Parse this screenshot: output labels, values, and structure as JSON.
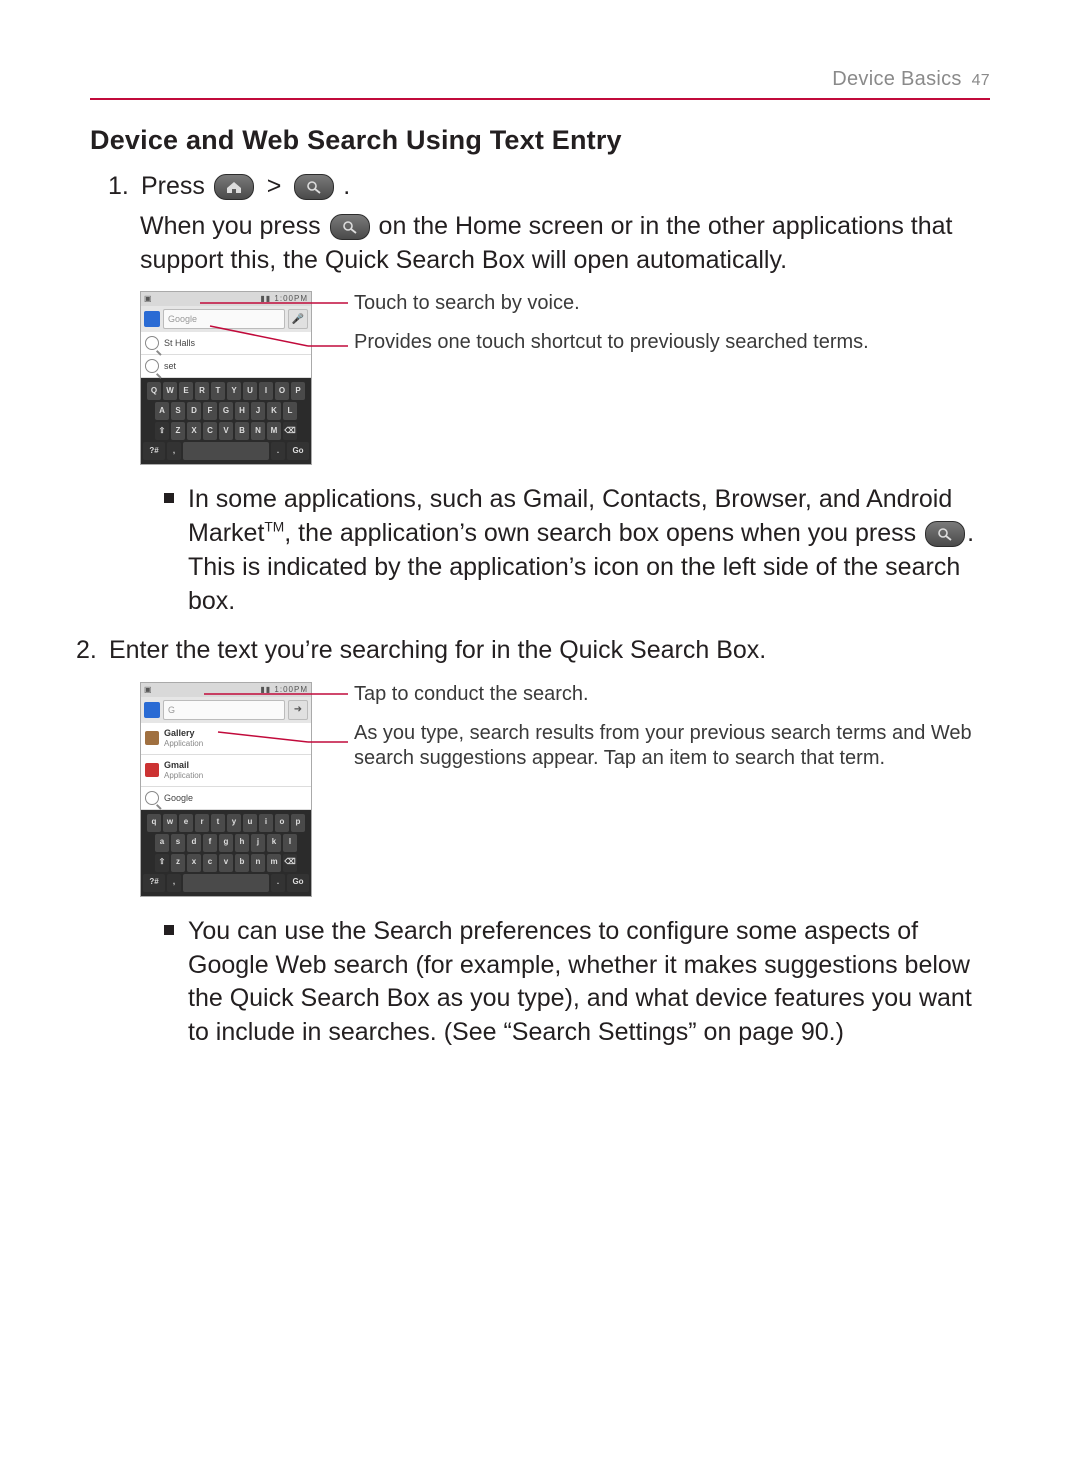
{
  "header": {
    "section": "Device Basics",
    "page_number": "47"
  },
  "title": "Device and Web Search Using Text Entry",
  "step1": {
    "number": "1.",
    "press_word": "Press",
    "press_tail": ".",
    "separator": ">",
    "body": "When you press          on the Home screen or in the other applications that support this, the Quick Search Box will open automatically.",
    "body_before": "When you press ",
    "body_after": " on the Home screen or in the other applications that support this, the Quick Search Box will open automatically.",
    "callout_voice": "Touch to search by voice.",
    "callout_shortcut": "Provides one touch shortcut to previously searched terms.",
    "bullet_before": "In some applications, such as Gmail, Contacts, Browser, and Android Market",
    "bullet_tm": "TM",
    "bullet_mid": ", the application’s own search box opens when you press ",
    "bullet_after": ". This is indicated by the application’s icon on the left side of the search box.",
    "thumb": {
      "time": "1:00PM",
      "input_placeholder": "Google",
      "suggest1": "St Halls",
      "suggest2": "set",
      "kbd_rows": [
        [
          "Q",
          "W",
          "E",
          "R",
          "T",
          "Y",
          "U",
          "I",
          "O",
          "P"
        ],
        [
          "A",
          "S",
          "D",
          "F",
          "G",
          "H",
          "J",
          "K",
          "L"
        ],
        [
          "⇧",
          "Z",
          "X",
          "C",
          "V",
          "B",
          "N",
          "M",
          "⌫"
        ],
        [
          "?#",
          ",",
          " ",
          ".",
          "Go"
        ]
      ]
    }
  },
  "step2": {
    "number": "2.",
    "body": "Enter the text you’re searching for in the Quick Search Box.",
    "callout_go": "Tap to conduct the search.",
    "callout_results": "As you type, search results from your previous search terms and Web search suggestions appear. Tap an item to search that term.",
    "bullet": "You can use the Search preferences to configure some aspects of Google Web search (for example, whether it makes suggestions below the Quick Search Box as you type), and what device features you want to include in searches. (See “Search Settings” on page 90.)",
    "thumb": {
      "time": "1:00PM",
      "input_value": "G",
      "res1_title": "Gallery",
      "res1_sub": "Application",
      "res2_title": "Gmail",
      "res2_sub": "Application",
      "res3_title": "Google",
      "kbd_rows": [
        [
          "q",
          "w",
          "e",
          "r",
          "t",
          "y",
          "u",
          "i",
          "o",
          "p"
        ],
        [
          "a",
          "s",
          "d",
          "f",
          "g",
          "h",
          "j",
          "k",
          "l"
        ],
        [
          "⇧",
          "z",
          "x",
          "c",
          "v",
          "b",
          "n",
          "m",
          "⌫"
        ],
        [
          "?#",
          ",",
          " ",
          ".",
          "Go"
        ]
      ]
    }
  }
}
